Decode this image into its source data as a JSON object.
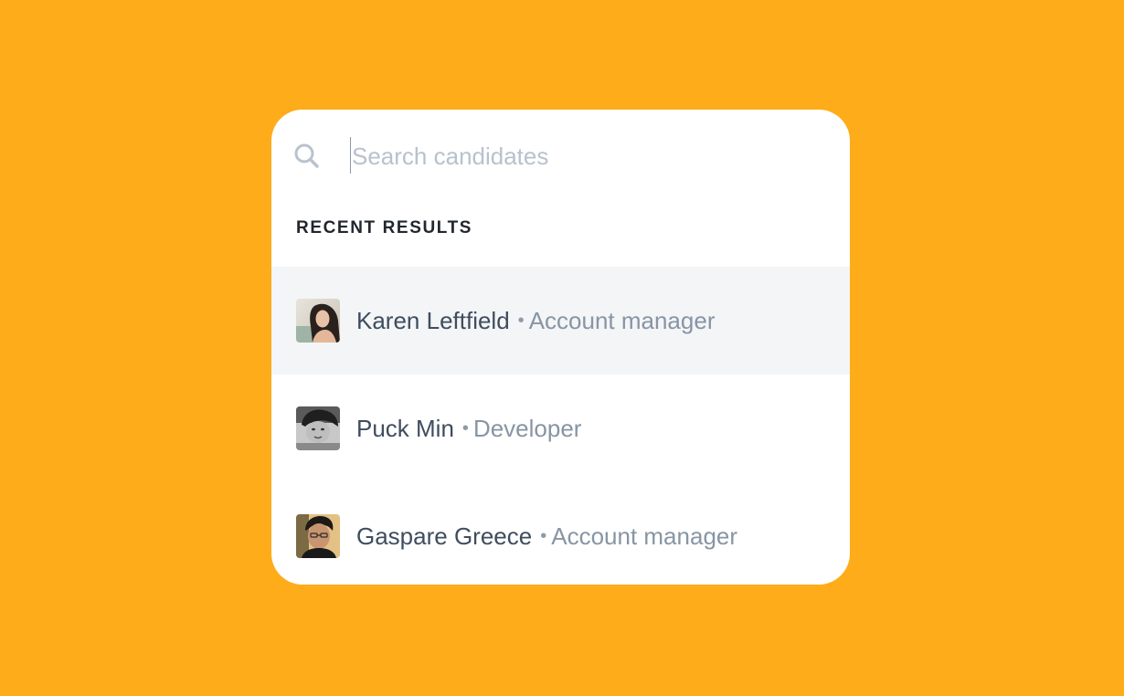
{
  "search": {
    "placeholder": "Search candidates",
    "icon": "search-icon"
  },
  "section": {
    "title": "RECENT RESULTS"
  },
  "separator": "•",
  "results": [
    {
      "name": "Karen Leftfield",
      "role": "Account manager",
      "selected": true,
      "avatar": "avatar-photo"
    },
    {
      "name": "Puck Min",
      "role": "Developer",
      "selected": false,
      "avatar": "avatar-photo"
    },
    {
      "name": "Gaspare Greece",
      "role": "Account manager",
      "selected": false,
      "avatar": "avatar-photo"
    }
  ],
  "colors": {
    "background": "#FEAC19",
    "card": "#FFFFFF",
    "selected_row": "#F3F5F7",
    "name_text": "#3F4D5E",
    "role_text": "#8795A4",
    "placeholder": "#B7C2CD"
  }
}
